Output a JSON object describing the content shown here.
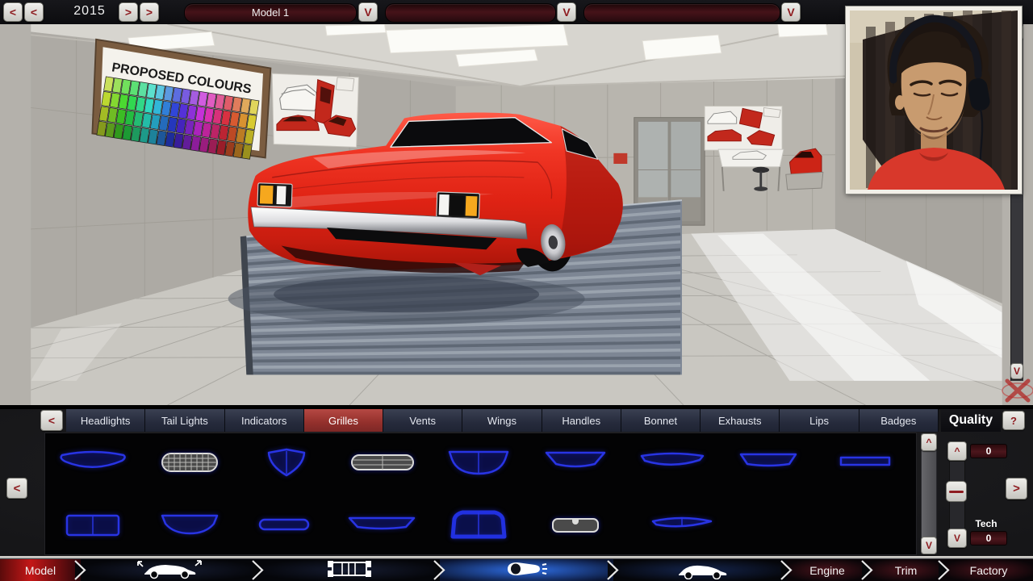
{
  "top_bar": {
    "year": "2015",
    "year_controls": {
      "prev": [
        "<",
        "<"
      ],
      "next": [
        ">",
        ">"
      ]
    },
    "dropdowns": [
      {
        "value": "Model 1",
        "button": "V"
      },
      {
        "value": "",
        "button": "V"
      },
      {
        "value": "",
        "button": "V"
      }
    ]
  },
  "scene": {
    "poster_title": "PROPOSED COLOURS"
  },
  "viewport": {
    "scroll_down_button": "V"
  },
  "fixture_panel": {
    "back_button": "<",
    "tabs": [
      "Headlights",
      "Tail Lights",
      "Indicators",
      "Grilles",
      "Vents",
      "Wings",
      "Handles",
      "Bonnet",
      "Exhausts",
      "Lips",
      "Badges"
    ],
    "selected_tab": "Grilles",
    "quality_title": "Quality",
    "help_button": "?",
    "prev_page_button": "<",
    "next_page_button": ">",
    "list_scroll_up": "^",
    "list_scroll_down": "V",
    "quality": {
      "up": "^",
      "down": "V",
      "value": "0",
      "tech_label": "Tech",
      "tech_value": "0"
    },
    "parts": {
      "row1": [
        {
          "shape": "smile-wide"
        },
        {
          "shape": "mesh-oval"
        },
        {
          "shape": "shield"
        },
        {
          "shape": "slat-oval"
        },
        {
          "shape": "halfround-split"
        },
        {
          "shape": "trapezoid"
        },
        {
          "shape": "smile-thin"
        },
        {
          "shape": "trapezoid-thin"
        },
        {
          "shape": "bar-flat"
        }
      ],
      "row2": [
        {
          "shape": "rect-split"
        },
        {
          "shape": "trapezoid-round"
        },
        {
          "shape": "pill-thin"
        },
        {
          "shape": "trapezoid-wide-thin"
        },
        {
          "shape": "dome-split"
        },
        {
          "shape": "pill-notch"
        },
        {
          "shape": "lens-split"
        }
      ]
    }
  },
  "nav_bar": {
    "steps": [
      {
        "type": "text",
        "label": "Model",
        "accent": "red",
        "active": false
      },
      {
        "type": "icon",
        "icon": "styling-icon",
        "accent": "dark",
        "active": false
      },
      {
        "type": "icon",
        "icon": "chassis-icon",
        "accent": "dark",
        "active": false
      },
      {
        "type": "icon",
        "icon": "headlight-icon",
        "accent": "blue",
        "active": true
      },
      {
        "type": "icon",
        "icon": "trim-car-icon",
        "accent": "navy",
        "active": false
      },
      {
        "type": "text",
        "label": "Engine",
        "accent": "maroon",
        "active": false
      },
      {
        "type": "text",
        "label": "Trim",
        "accent": "maroon",
        "active": false
      },
      {
        "type": "text",
        "label": "Factory",
        "accent": "maroon",
        "active": false
      }
    ]
  },
  "colors": {
    "accent_red": "#a03434",
    "part_blue": "#2834e4",
    "active_blue": "#2e6de4",
    "car_red": "#e82517",
    "chrome": "#dcdde0"
  }
}
